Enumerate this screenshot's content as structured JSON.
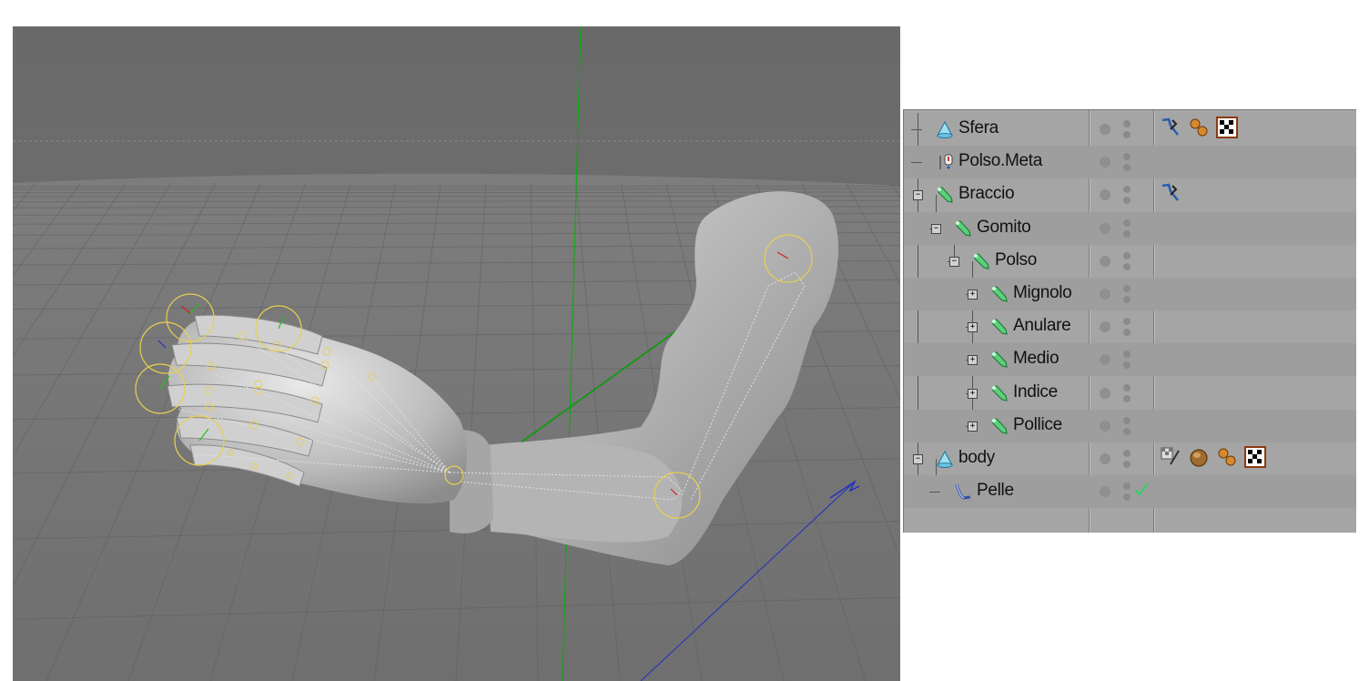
{
  "viewport": {
    "background": "#6b6b6b",
    "model": "arm-with-hand",
    "axis_colors": {
      "y": "#00b000",
      "z": "#2030c0"
    }
  },
  "object_manager": {
    "rows": [
      {
        "label": "Sfera",
        "type": "polygon-object",
        "icon": "cone-object-icon",
        "depth": 0,
        "expander": "none",
        "tags": [
          "ik-tag-icon",
          "material-spheres-icon",
          "checker-texture-icon"
        ]
      },
      {
        "label": "Polso.Meta",
        "type": "null-object",
        "icon": "null-object-icon",
        "depth": 0,
        "expander": "none",
        "tags": []
      },
      {
        "label": "Braccio",
        "type": "bone",
        "icon": "bone-icon",
        "depth": 0,
        "expander": "minus",
        "tags": [
          "ik-tag-icon"
        ]
      },
      {
        "label": "Gomito",
        "type": "bone",
        "icon": "bone-icon",
        "depth": 1,
        "expander": "minus",
        "tags": []
      },
      {
        "label": "Polso",
        "type": "bone",
        "icon": "bone-icon",
        "depth": 2,
        "expander": "minus",
        "tags": []
      },
      {
        "label": "Mignolo",
        "type": "bone",
        "icon": "bone-icon",
        "depth": 3,
        "expander": "plus",
        "tags": []
      },
      {
        "label": "Anulare",
        "type": "bone",
        "icon": "bone-icon",
        "depth": 3,
        "expander": "plus",
        "tags": []
      },
      {
        "label": "Medio",
        "type": "bone",
        "icon": "bone-icon",
        "depth": 3,
        "expander": "plus",
        "tags": []
      },
      {
        "label": "Indice",
        "type": "bone",
        "icon": "bone-icon",
        "depth": 3,
        "expander": "plus",
        "tags": []
      },
      {
        "label": "Pollice",
        "type": "bone",
        "icon": "bone-icon",
        "depth": 3,
        "expander": "plus",
        "tags": []
      },
      {
        "label": "body",
        "type": "polygon-object",
        "icon": "cone-object-icon",
        "depth": 0,
        "expander": "minus",
        "tags": [
          "texture-tag-icon",
          "wood-material-icon",
          "material-spheres-icon",
          "checker-texture-icon"
        ]
      },
      {
        "label": "Pelle",
        "type": "skin-deformer",
        "icon": "skin-deformer-icon",
        "depth": 1,
        "expander": "none",
        "enabled_check": true,
        "tags": []
      }
    ]
  }
}
